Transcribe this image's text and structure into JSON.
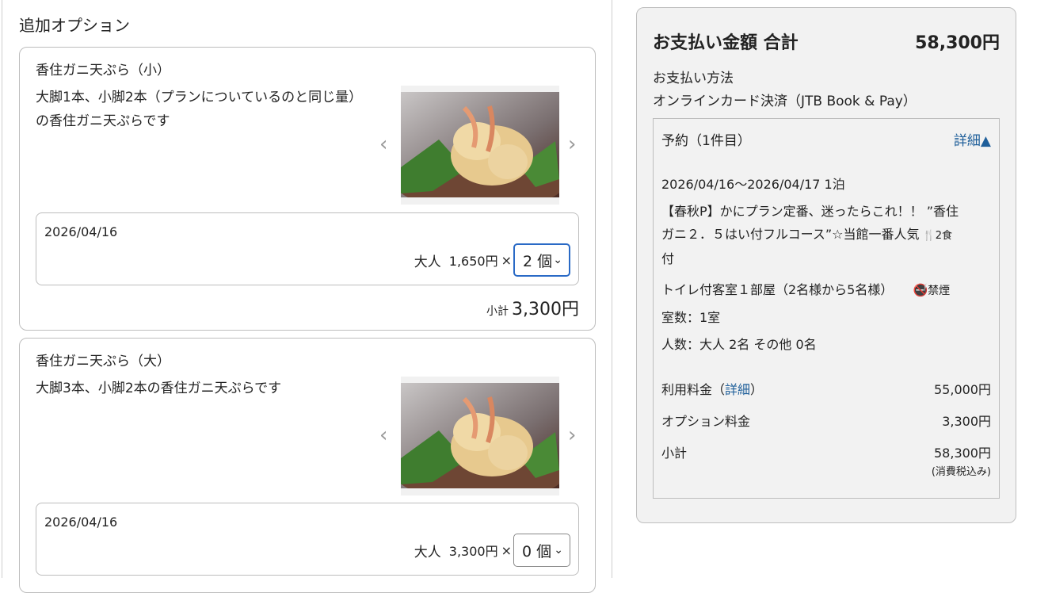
{
  "section_title": "追加オプション",
  "options": [
    {
      "name": "香住ガニ天ぷら（小）",
      "desc_line1": "大脚1本、小脚2本（プランについているのと同じ量）",
      "desc_line2": "の香住ガニ天ぷらです",
      "date": "2026/04/16",
      "qty_label": "大人",
      "unit_price": "1,650円",
      "times": "×",
      "qty_value": "2 個",
      "subtotal_label": "小計",
      "subtotal_value": "3,300円"
    },
    {
      "name": "香住ガニ天ぷら（大）",
      "desc_line1": "大脚3本、小脚2本の香住ガニ天ぷらです",
      "desc_line2": "",
      "date": "2026/04/16",
      "qty_label": "大人",
      "unit_price": "3,300円",
      "times": "×",
      "qty_value": "0 個"
    }
  ],
  "icons": {
    "prev": "chevron-left-icon",
    "next": "chevron-right-icon",
    "select": "chevron-down-icon",
    "meal": "fork-knife-icon",
    "nosmoke": "no-smoking-icon"
  },
  "summary": {
    "title": "お支払い金額 合計",
    "total": "58,300円",
    "payment_label": "お支払い方法",
    "payment_method": "オンラインカード決済（JTB Book & Pay）",
    "reservation": {
      "heading": "予約（1件目）",
      "detail_toggle": "詳細▲",
      "dates": "2026/04/16～2026/04/17  1泊",
      "plan_line1": "【春秋P】かにプラン定番、迷ったらこれ！！ ”香住",
      "plan_line2": "ガニ２．５はい付フルコース”☆当館一番人気",
      "meal_label": "2食",
      "plan_line3": "付",
      "room": "トイレ付客室１部屋（2名様から5名様）",
      "nosmoke": "禁煙",
      "room_count": "室数：1室",
      "people": "人数：大人 2名  その他 0名",
      "fee_label_pre": "利用料金（",
      "fee_link": "詳細",
      "fee_label_post": "）",
      "fee_value": "55,000円",
      "option_fee_label": "オプション料金",
      "option_fee_value": "3,300円",
      "subtotal_label": "小計",
      "subtotal_value": "58,300円",
      "tax_note": "(消費税込み)"
    }
  }
}
